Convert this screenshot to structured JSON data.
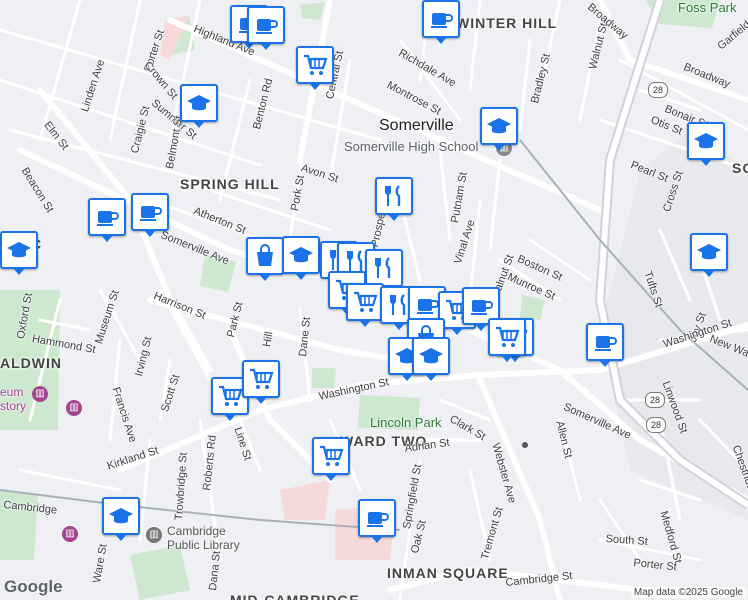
{
  "map": {
    "places": [
      "WINTER HILL",
      "SPRING HILL",
      "WARD TWO",
      "INMAN SQUARE",
      "RIC",
      "ALDWIN",
      "MID-CAMBRIDGE",
      "SO"
    ],
    "city": "Somerville",
    "pois": {
      "high_school": "Somerville High School",
      "park": "Lincoln Park",
      "park2": "Foss Park",
      "library_line1": "Cambridge",
      "library_line2": "Public Library",
      "museum_line1": "eum",
      "museum_line2": "story"
    },
    "route_shields": [
      "28",
      "28",
      "28"
    ],
    "streets": [
      "Highland Ave",
      "Porter St",
      "Crown St",
      "Linden Ave",
      "Summer St",
      "Belmont St",
      "Craigie St",
      "Elm St",
      "Beacon St",
      "Somerville Ave",
      "Benton Rd",
      "Central St",
      "Avon St",
      "Atherton St",
      "Harrison St",
      "Museum St",
      "Park St",
      "Hammond St",
      "Oxford St",
      "Irving St",
      "Francis Ave",
      "Scott St",
      "Kirkland St",
      "Line St",
      "Trowbridge St",
      "Roberts Rd",
      "Dana St",
      "Dane St",
      "Washington St",
      "Clark St",
      "Adrian St",
      "Webster Ave",
      "Springfield St",
      "Oak St",
      "Tremont St",
      "Cambridge St",
      "Prospect St",
      "Vinal Ave",
      "Putnam St",
      "Walnut St",
      "Boston St",
      "Munroe St",
      "Richdale Ave",
      "Montrose St",
      "Bradley St",
      "Walnut St",
      "Broadway",
      "Bonair St",
      "Otis St",
      "Pearl St",
      "Cross St",
      "Tufts St",
      "Joy St",
      "Linwood St",
      "Allen St",
      "Medford St",
      "South St",
      "Porter St",
      "Chestnut",
      "Garfield",
      "Broadway",
      "New Wa",
      "Washington St",
      "Somerville Ave",
      "Pork St",
      "Hill",
      "Cambridge",
      "Ware St"
    ],
    "attribution": "Map data ©2025 Google",
    "logo": "Google"
  },
  "markers": [
    {
      "icon": "coffee-icon"
    },
    {
      "icon": "coffee-icon"
    },
    {
      "icon": "coffee-icon"
    },
    {
      "icon": "cart-icon"
    },
    {
      "icon": "school-icon"
    },
    {
      "icon": "school-icon"
    },
    {
      "icon": "school-icon"
    },
    {
      "icon": "fork-knife-icon"
    },
    {
      "icon": "coffee-icon"
    },
    {
      "icon": "coffee-icon"
    },
    {
      "icon": "school-icon"
    },
    {
      "icon": "bag-icon"
    },
    {
      "icon": "school-icon"
    },
    {
      "icon": "fork-knife-icon"
    },
    {
      "icon": "fork-knife-icon"
    },
    {
      "icon": "fork-knife-icon"
    },
    {
      "icon": "cart-icon"
    },
    {
      "icon": "cart-icon"
    },
    {
      "icon": "fork-knife-icon"
    },
    {
      "icon": "coffee-icon"
    },
    {
      "icon": "cart-icon"
    },
    {
      "icon": "coffee-icon"
    },
    {
      "icon": "cart-icon"
    },
    {
      "icon": "coffee-icon"
    },
    {
      "icon": "cart-icon"
    },
    {
      "icon": "bag-icon"
    },
    {
      "icon": "school-icon"
    },
    {
      "icon": "school-icon"
    },
    {
      "icon": "cart-icon"
    },
    {
      "icon": "cart-icon"
    },
    {
      "icon": "cart-icon"
    },
    {
      "icon": "coffee-icon"
    },
    {
      "icon": "school-icon"
    },
    {
      "icon": "school-icon"
    }
  ],
  "colors": {
    "marker_border": "#1a73e8",
    "park": "#c8e6c9",
    "water": "#aadaff",
    "road": "#ffffff"
  }
}
